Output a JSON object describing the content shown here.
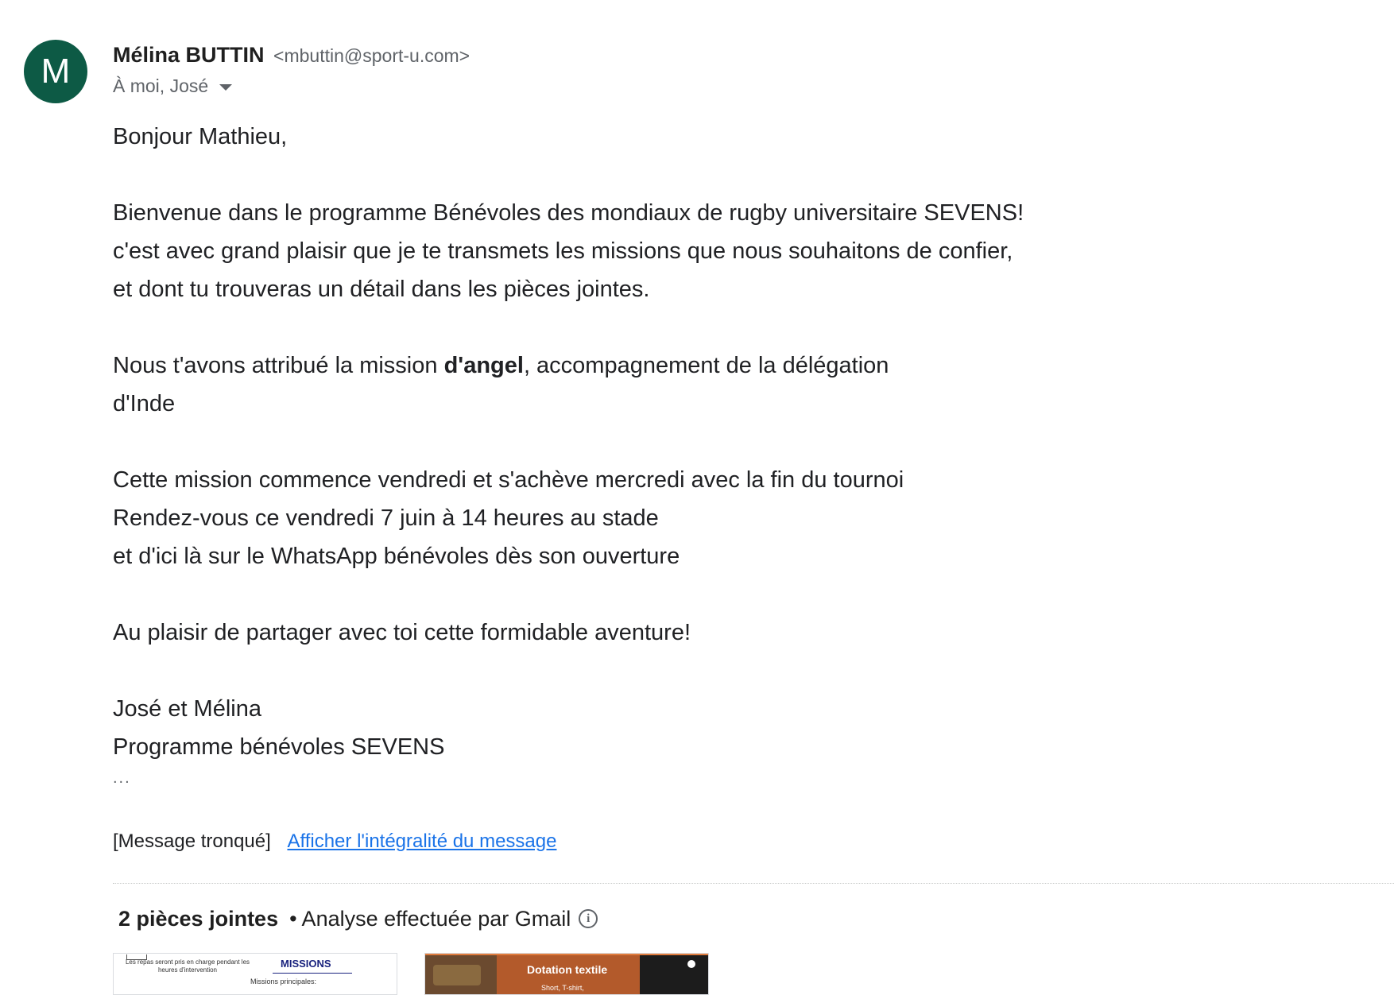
{
  "sender": {
    "avatar_letter": "M",
    "avatar_color": "#0d5a45",
    "name": "Mélina BUTTIN",
    "email": "<mbuttin@sport-u.com>",
    "recipients": "À moi, José",
    "recipients_icon": "caret-down-icon"
  },
  "body": {
    "greeting": "Bonjour Mathieu,",
    "para1": [
      "Bienvenue dans le programme Bénévoles des mondiaux de rugby universitaire SEVENS!",
      "c'est avec grand plaisir que je te transmets les missions que nous souhaitons de confier,",
      "et dont tu trouveras un détail dans les pièces jointes."
    ],
    "para2": {
      "before": "Nous t'avons attribué la mission ",
      "bold": "d'angel",
      "after": ", accompagnement de la délégation",
      "line2": "d'Inde"
    },
    "para3": [
      "Cette mission commence vendredi et s'achève mercredi avec la fin du tournoi",
      "Rendez-vous ce vendredi 7 juin à 14 heures au stade",
      "et d'ici là sur le WhatsApp bénévoles dès son ouverture"
    ],
    "para4": "Au plaisir de partager avec toi cette formidable aventure!",
    "signature": [
      "José et Mélina",
      "Programme bénévoles SEVENS"
    ],
    "ellipsis": "..."
  },
  "truncation": {
    "label": "[Message tronqué]",
    "link": "Afficher l'intégralité du message",
    "link_color": "#1a73e8"
  },
  "attachments": {
    "count_label": "2 pièces jointes",
    "scan_label": "• Analyse effectuée par Gmail",
    "info_icon": "info-icon",
    "thumb1": {
      "left_text": "Les repas seront pris en charge pendant les heures d'intervention",
      "title": "MISSIONS",
      "subtitle": "Missions principales:"
    },
    "thumb2": {
      "title": "Dotation textile",
      "subtitle": "Short, T-shirt,"
    }
  }
}
